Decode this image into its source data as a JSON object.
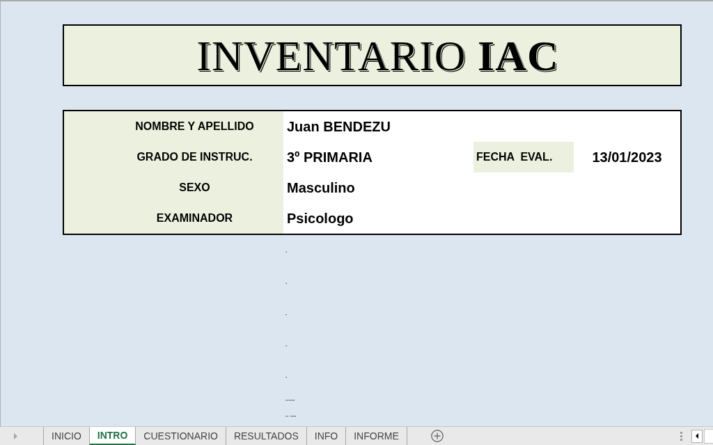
{
  "title": "INVENTARIO **IAC**",
  "fields": [
    {
      "label": "NOMBRE Y APELLIDO",
      "value": "Juan BENDEZU"
    },
    {
      "label": "GRADO DE INSTRUC.",
      "value": "3º PRIMARIA"
    },
    {
      "label": "SEXO",
      "value": "Masculino"
    },
    {
      "label": "EXAMINADOR",
      "value": "Psicologo"
    }
  ],
  "evaluation_date": {
    "label": "FECHA  EVAL.",
    "value": "13/01/2023"
  },
  "dots": [
    ".",
    ".",
    ".",
    ".",
    ".",
    "......",
    ".. ...."
  ],
  "sheet_tabs": [
    {
      "label": "INICIO",
      "selected": false
    },
    {
      "label": "INTRO",
      "selected": true
    },
    {
      "label": "CUESTIONARIO",
      "selected": false
    },
    {
      "label": "RESULTADOS",
      "selected": false
    },
    {
      "label": "INFO",
      "selected": false
    },
    {
      "label": "INFORME",
      "selected": false
    }
  ]
}
